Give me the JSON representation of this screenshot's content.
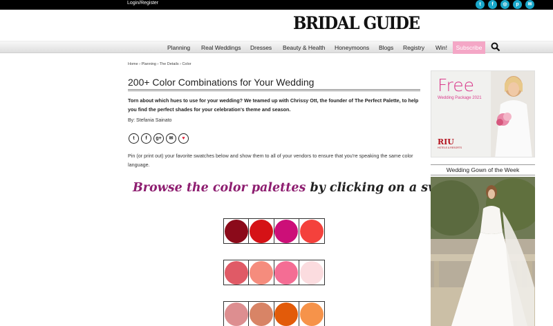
{
  "topbar": {
    "login": "Login/Register",
    "social": [
      {
        "icon": "twitter-icon",
        "glyph": "t"
      },
      {
        "icon": "facebook-icon",
        "glyph": "f"
      },
      {
        "icon": "instagram-icon",
        "glyph": "◎"
      },
      {
        "icon": "pinterest-icon",
        "glyph": "p"
      },
      {
        "icon": "email-icon",
        "glyph": "✉"
      }
    ]
  },
  "logo": "BRIDAL GUIDE",
  "nav": {
    "items": [
      "Planning",
      "Real Weddings",
      "Dresses",
      "Beauty & Health",
      "Honeymoons",
      "Blogs",
      "Registry",
      "Win!"
    ],
    "subscribe": "Subscribe",
    "accent": "#f4a7c6"
  },
  "article": {
    "breadcrumb": "Home › Planning › The Details › Color",
    "title": "200+ Color Combinations for Your Wedding",
    "intro": "Torn about which hues to use for your wedding? We teamed up with Chrissy Ott, the founder of The Perfect Palette, to help you find the perfect shades for your celebration's theme and season.",
    "byline": "By: Stefania Sainato",
    "share": [
      "twitter-icon",
      "facebook-icon",
      "google-plus-icon",
      "email-icon",
      "heart-icon"
    ],
    "pin_text": "Pin (or print out) your favorite swatches below and show them to all of your vendors to ensure that you're speaking the same color language.",
    "browse_part1": "Browse the color palettes",
    "browse_part2": "by clicking on a swatch!",
    "palettes": [
      [
        "#8b0a1a",
        "#d51216",
        "#cc0f78",
        "#f4413c"
      ],
      [
        "#e05a66",
        "#f58c7d",
        "#f46d94",
        "#fbdcdf"
      ],
      [
        "#dd8e90",
        "#d88466",
        "#e25b0a",
        "#f6934a"
      ]
    ]
  },
  "sidebar": {
    "ad_title": "Free",
    "ad_sub": "Wedding Package 2021",
    "ad_brand": "RIU",
    "ad_brand_sub": "HOTELS & RESORTS",
    "gown_heading": "Wedding Gown of the Week"
  }
}
